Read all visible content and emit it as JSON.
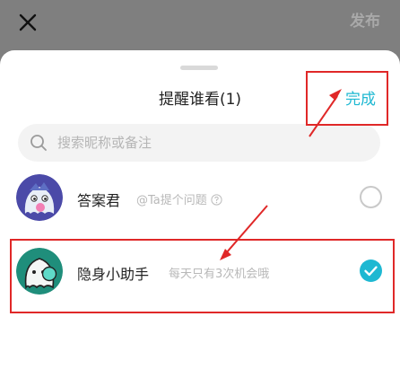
{
  "top_bar": {
    "publish_label": "发布",
    "close_icon": "close-icon"
  },
  "sheet": {
    "title": "提醒谁看(1)",
    "done_label": "完成"
  },
  "search": {
    "placeholder": "搜索昵称或备注",
    "icon": "search-icon"
  },
  "users": [
    {
      "name": "答案君",
      "description": "@Ta提个问题",
      "selected": false,
      "avatar_icon": "ghost-avatar-purple"
    },
    {
      "name": "隐身小助手",
      "description": "每天只有3次机会哦",
      "selected": true,
      "avatar_icon": "ghost-avatar-green"
    }
  ],
  "colors": {
    "accent": "#1eb8d2",
    "annotation": "#e02828",
    "overlay": "#7f7f7f"
  }
}
